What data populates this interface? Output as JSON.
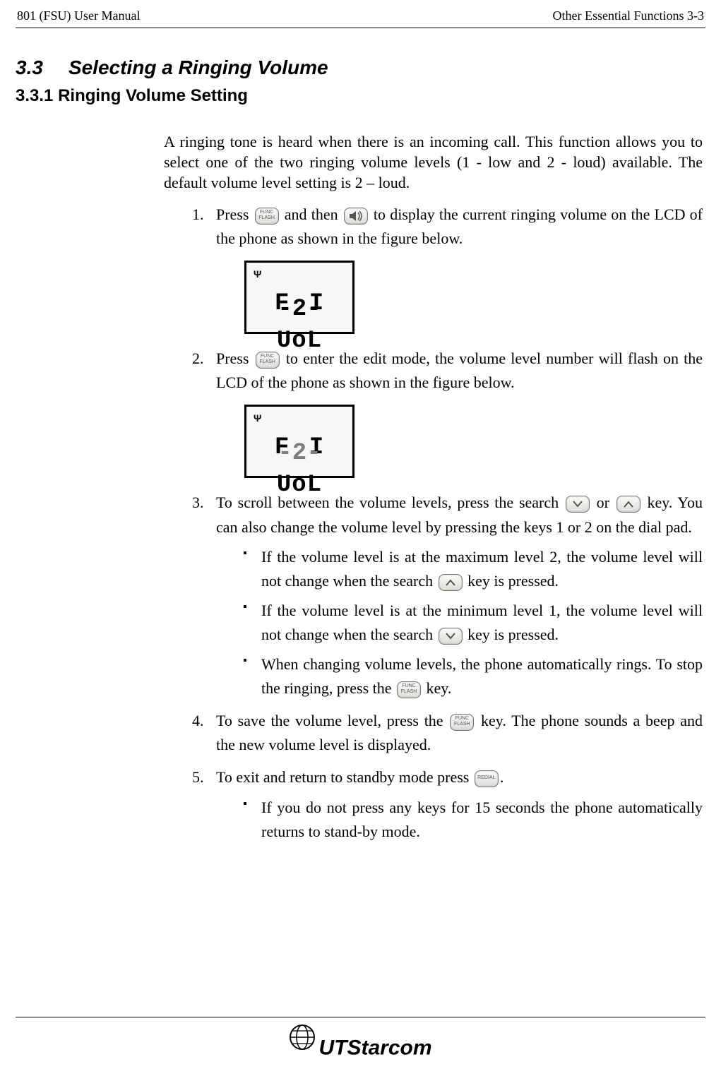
{
  "header": {
    "left": "801 (FSU) User Manual",
    "right": "Other Essential Functions    3-3"
  },
  "section": {
    "num": "3.3",
    "title": "Selecting a Ringing Volume",
    "sub_num": "3.3.1",
    "sub_title": "Ringing Volume Setting"
  },
  "intro": "A ringing tone is heard when there is an incoming call. This function allows you to select one of the two ringing volume levels (1 - low and 2 - loud) available. The default volume level setting is 2 – loud.",
  "steps": {
    "s1a": "Press ",
    "s1b": " and then ",
    "s1c": " to display the current ringing volume on the LCD of the phone as shown in the figure below.",
    "s2a": "Press ",
    "s2b": " to enter the edit mode, the volume level number will flash on the LCD of the phone as shown in the figure below.",
    "s3a": "To scroll between the volume levels, press the search ",
    "s3b": " or ",
    "s3c": " key. You can also change the volume level by pressing the keys 1 or 2 on the dial pad.",
    "s4a": "To save the volume level, press the ",
    "s4b": " key. The phone sounds a beep and the new volume level is displayed.",
    "s5a": "To exit and return to standby mode press ",
    "s5b": "."
  },
  "bullets": {
    "b1a": "If the volume level is at the maximum level 2, the volume level will not change when the search ",
    "b1b": " key is pressed.",
    "b2a": "If the volume level is at the minimum level 1, the volume level will not change when the search ",
    "b2b": " key is pressed.",
    "b3a": "When changing volume levels, the phone automatically rings. To stop the ringing, press the ",
    "b3b": " key.",
    "b5": "If you do not press any keys for 15 seconds the phone automatically returns to stand-by mode."
  },
  "lcd": {
    "line1": "F I  UoL",
    "line2": "-2-"
  },
  "keys": {
    "func": "func-flash-key",
    "speaker": "speaker-key",
    "down": "search-down-key",
    "up": "search-up-key",
    "redial": "redial-key"
  },
  "footer": {
    "brand": "UTStarcom"
  }
}
